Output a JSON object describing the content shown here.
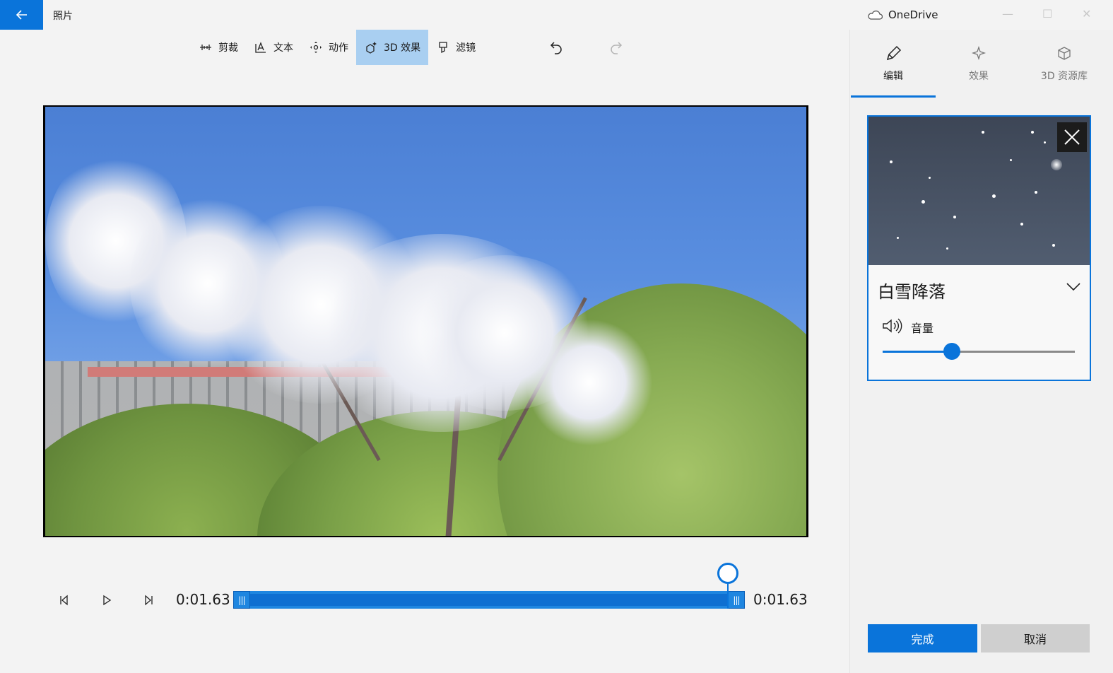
{
  "window": {
    "title": "照片",
    "account": "OneDrive"
  },
  "toolbar": {
    "items": [
      {
        "label": "剪裁",
        "icon": "trim-icon"
      },
      {
        "label": "文本",
        "icon": "text-icon"
      },
      {
        "label": "动作",
        "icon": "motion-icon"
      },
      {
        "label": "3D 效果",
        "icon": "3d-effects-icon"
      },
      {
        "label": "滤镜",
        "icon": "filter-icon"
      }
    ]
  },
  "playback": {
    "start_time": "0:01.63",
    "end_time": "0:01.63"
  },
  "panel": {
    "tabs": [
      {
        "label": "编辑"
      },
      {
        "label": "效果"
      },
      {
        "label": "3D 资源库"
      }
    ],
    "effect": {
      "name": "白雪降落",
      "volume_label": "音量",
      "volume_level": 0.36
    },
    "done_label": "完成",
    "cancel_label": "取消"
  },
  "colors": {
    "accent": "#0a74da",
    "active_tool": "#a9cff1"
  }
}
